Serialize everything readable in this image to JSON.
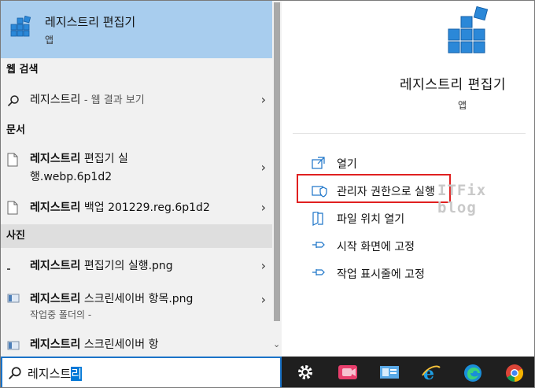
{
  "best_match": {
    "title": "레지스트리 편집기",
    "subtitle": "앱",
    "icon": "registry-editor-icon"
  },
  "sections": {
    "web": "웹 검색",
    "documents": "문서",
    "photos": "사진"
  },
  "web_result": {
    "query": "레지스트리",
    "suffix": "- 웹 결과 보기"
  },
  "documents": [
    {
      "bold": "레지스트리",
      "rest": " 편집기 실",
      "line2": "행.webp.6p1d2"
    },
    {
      "bold": "레지스트리",
      "rest": " 백업 201229.reg.6p1d2"
    }
  ],
  "photos": [
    {
      "bold": "레지스트리",
      "rest": " 편집기의 실행.png"
    },
    {
      "bold": "레지스트리",
      "rest": " 스크린세이버 항목.png",
      "sub": "작업중 폴더의 -"
    },
    {
      "bold": "레지스트리",
      "rest": " 스크린세이버 항"
    }
  ],
  "search": {
    "typed": "레지스트",
    "selected": "리"
  },
  "details": {
    "name": "레지스트리 편집기",
    "type": "앱",
    "actions": [
      {
        "label": "열기",
        "icon": "open-icon"
      },
      {
        "label": "관리자 권한으로 실행",
        "icon": "shield-icon"
      },
      {
        "label": "파일 위치 열기",
        "icon": "folder-location-icon"
      },
      {
        "label": "시작 화면에 고정",
        "icon": "pin-icon"
      },
      {
        "label": "작업 표시줄에 고정",
        "icon": "pin-icon"
      }
    ]
  },
  "watermark": "ITFix blog",
  "taskbar": [
    "settings-icon",
    "video-app-icon",
    "remote-desktop-icon",
    "internet-explorer-icon",
    "edge-icon",
    "chrome-icon"
  ],
  "colors": {
    "selection": "#a8cdee",
    "highlight": "#e02020",
    "accent": "#0078d7"
  }
}
